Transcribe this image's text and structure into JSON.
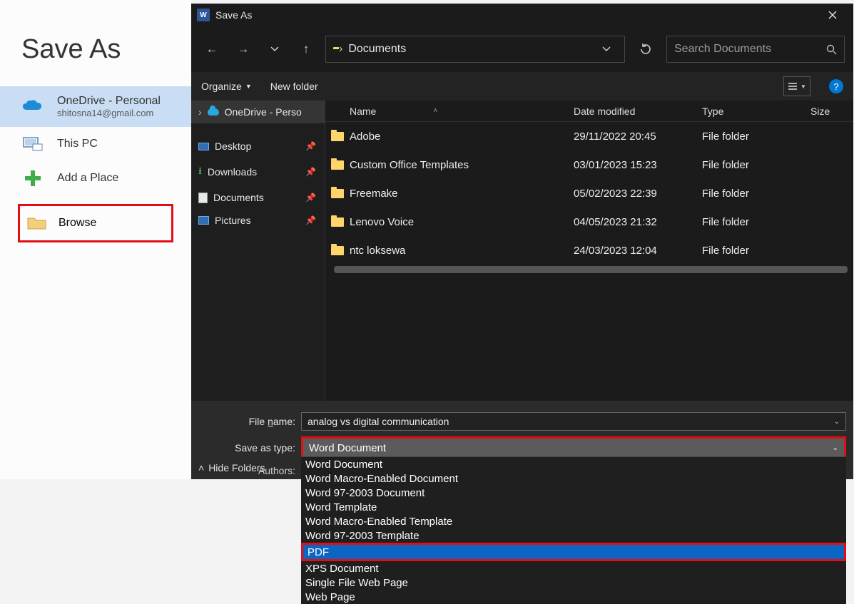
{
  "primary": {
    "title": "Save As",
    "items": [
      {
        "label": "OneDrive - Personal",
        "sub": "shitosna14@gmail.com"
      },
      {
        "label": "This PC"
      },
      {
        "label": "Add a Place"
      },
      {
        "label": "Browse"
      }
    ]
  },
  "dialog": {
    "title": "Save As",
    "path_current": "Documents",
    "search_placeholder": "Search Documents",
    "toolbar": {
      "organize": "Organize",
      "newfolder": "New folder"
    },
    "tree": [
      {
        "label": "OneDrive - Perso"
      },
      {
        "label": "Desktop"
      },
      {
        "label": "Downloads"
      },
      {
        "label": "Documents"
      },
      {
        "label": "Pictures"
      }
    ],
    "columns": {
      "name": "Name",
      "date": "Date modified",
      "type": "Type",
      "size": "Size"
    },
    "files": [
      {
        "name": "Adobe",
        "date": "29/11/2022 20:45",
        "type": "File folder"
      },
      {
        "name": "Custom Office Templates",
        "date": "03/01/2023 15:23",
        "type": "File folder"
      },
      {
        "name": "Freemake",
        "date": "05/02/2023 22:39",
        "type": "File folder"
      },
      {
        "name": "Lenovo Voice",
        "date": "04/05/2023 21:32",
        "type": "File folder"
      },
      {
        "name": "ntc loksewa",
        "date": "24/03/2023 12:04",
        "type": "File folder"
      }
    ],
    "form": {
      "filename_label": "File name:",
      "filename_value": "analog vs digital communication",
      "type_label": "Save as type:",
      "type_value": "Word Document",
      "authors_label": "Authors:"
    },
    "type_options": [
      "Word Document",
      "Word Macro-Enabled Document",
      "Word 97-2003 Document",
      "Word Template",
      "Word Macro-Enabled Template",
      "Word 97-2003 Template",
      "PDF",
      "XPS Document",
      "Single File Web Page",
      "Web Page"
    ],
    "type_selected_index": 6,
    "hide_folders": "Hide Folders"
  }
}
